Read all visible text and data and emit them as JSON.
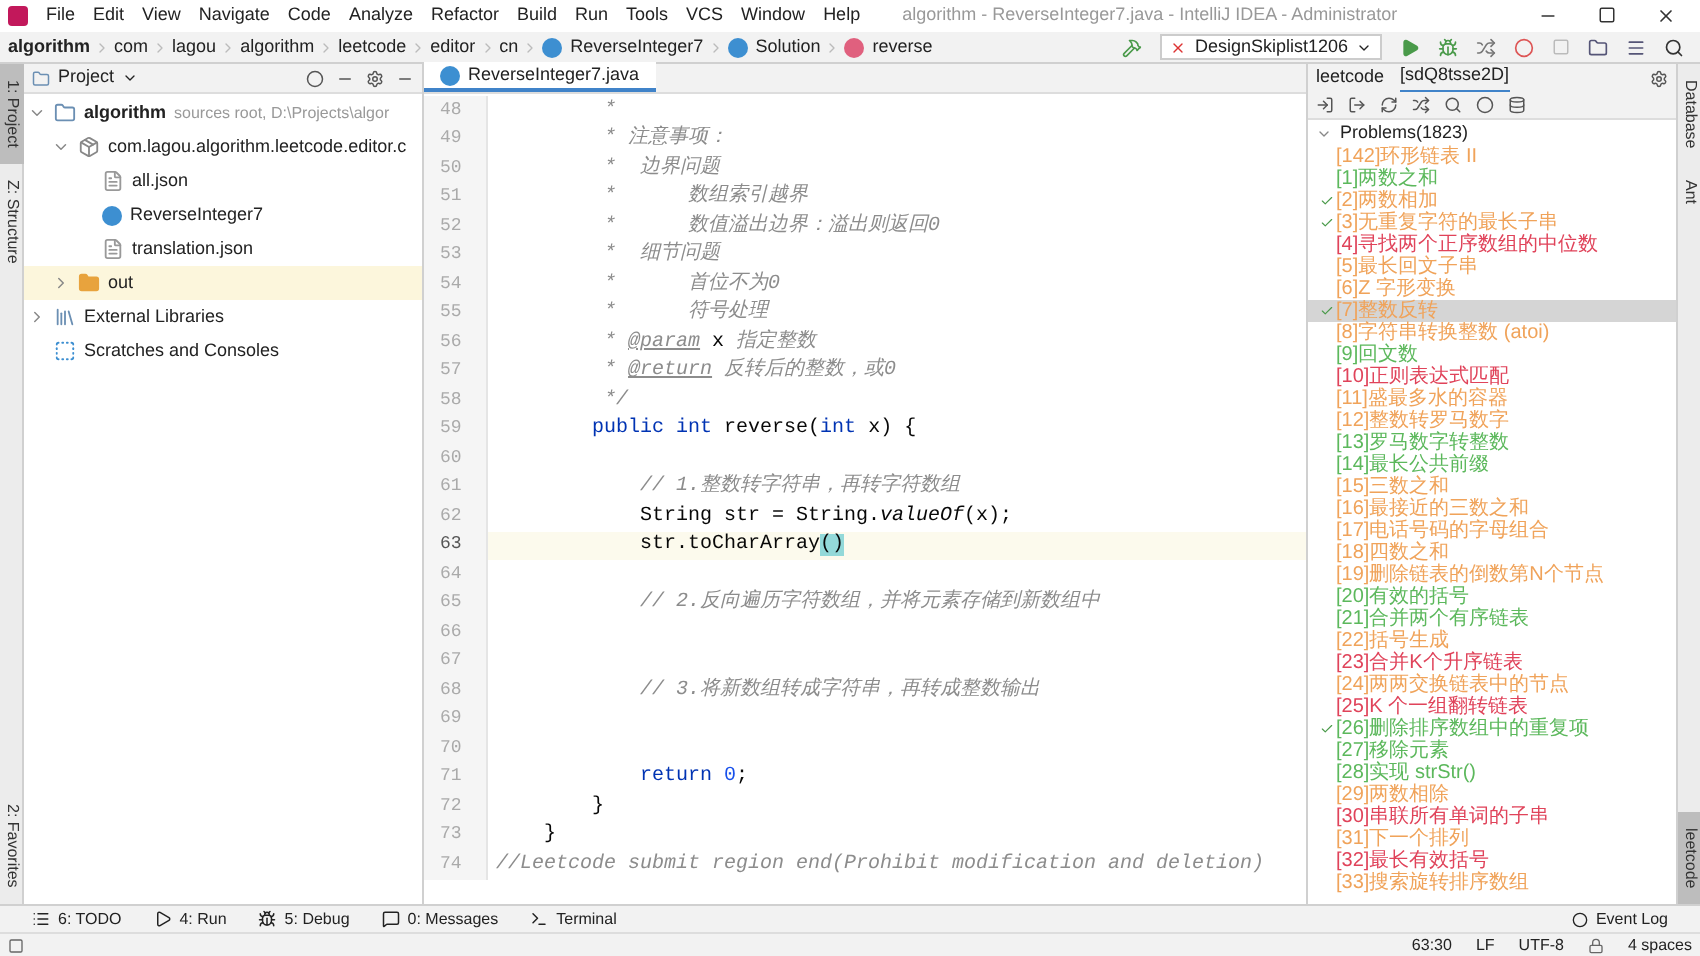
{
  "window": {
    "title": "algorithm - ReverseInteger7.java - IntelliJ IDEA - Administrator"
  },
  "menu": [
    "File",
    "Edit",
    "View",
    "Navigate",
    "Code",
    "Analyze",
    "Refactor",
    "Build",
    "Run",
    "Tools",
    "VCS",
    "Window",
    "Help"
  ],
  "breadcrumbs": [
    {
      "label": "algorithm",
      "kind": "project"
    },
    {
      "label": "com",
      "kind": "folder"
    },
    {
      "label": "lagou",
      "kind": "folder"
    },
    {
      "label": "algorithm",
      "kind": "folder"
    },
    {
      "label": "leetcode",
      "kind": "folder"
    },
    {
      "label": "editor",
      "kind": "folder"
    },
    {
      "label": "cn",
      "kind": "folder"
    },
    {
      "label": "ReverseInteger7",
      "kind": "class"
    },
    {
      "label": "Solution",
      "kind": "class"
    },
    {
      "label": "reverse",
      "kind": "method"
    }
  ],
  "run_config": "DesignSkiplist1206",
  "left_strip": [
    {
      "label": "1: Project",
      "selected": true
    },
    {
      "label": "Z: Structure",
      "selected": false
    }
  ],
  "left_strip_bottom": [
    {
      "label": "2: Favorites",
      "selected": false
    }
  ],
  "project_panel": {
    "title": "Project",
    "tree": [
      {
        "label": "algorithm",
        "note": "sources root, D:\\Projects\\algor",
        "kind": "module",
        "expanded": true,
        "selected": false,
        "children": [
          {
            "label": "com.lagou.algorithm.leetcode.editor.c",
            "kind": "package",
            "expanded": true,
            "selected": false,
            "children": [
              {
                "label": "all.json",
                "kind": "file",
                "selected": false
              },
              {
                "label": "ReverseInteger7",
                "kind": "class",
                "selected": false
              },
              {
                "label": "translation.json",
                "kind": "file",
                "selected": false
              }
            ]
          },
          {
            "label": "out",
            "kind": "folder",
            "expanded": false,
            "selected": true
          }
        ]
      },
      {
        "label": "External Libraries",
        "kind": "library",
        "expanded": false,
        "selected": false
      },
      {
        "label": "Scratches and Consoles",
        "kind": "scratch",
        "selected": false
      }
    ]
  },
  "editor": {
    "tab": "ReverseInteger7.java",
    "lines": [
      {
        "number": "48",
        "current": false,
        "segments": [
          {
            "kind": "doc",
            "text": "         *"
          }
        ]
      },
      {
        "number": "49",
        "current": false,
        "segments": [
          {
            "kind": "doc",
            "text": "         * 注意事项："
          }
        ]
      },
      {
        "number": "50",
        "current": false,
        "segments": [
          {
            "kind": "doc",
            "text": "         *  边界问题"
          }
        ]
      },
      {
        "number": "51",
        "current": false,
        "segments": [
          {
            "kind": "doc",
            "text": "         *      数组索引越界"
          }
        ]
      },
      {
        "number": "52",
        "current": false,
        "segments": [
          {
            "kind": "doc",
            "text": "         *      数值溢出边界：溢出则返回0"
          }
        ]
      },
      {
        "number": "53",
        "current": false,
        "segments": [
          {
            "kind": "doc",
            "text": "         *  细节问题"
          }
        ]
      },
      {
        "number": "54",
        "current": false,
        "segments": [
          {
            "kind": "doc",
            "text": "         *      首位不为0"
          }
        ]
      },
      {
        "number": "55",
        "current": false,
        "segments": [
          {
            "kind": "doc",
            "text": "         *      符号处理"
          }
        ]
      },
      {
        "number": "56",
        "current": false,
        "segments": [
          {
            "kind": "doc",
            "text": "         * "
          },
          {
            "kind": "doctag",
            "text": "@param"
          },
          {
            "kind": "plain",
            "text": " x "
          },
          {
            "kind": "doc",
            "text": "指定整数"
          }
        ]
      },
      {
        "number": "57",
        "current": false,
        "segments": [
          {
            "kind": "doc",
            "text": "         * "
          },
          {
            "kind": "doctag",
            "text": "@return"
          },
          {
            "kind": "doc",
            "text": " 反转后的整数，或0"
          }
        ]
      },
      {
        "number": "58",
        "current": false,
        "segments": [
          {
            "kind": "doc",
            "text": "         */"
          }
        ]
      },
      {
        "number": "59",
        "current": false,
        "segments": [
          {
            "kind": "keyword",
            "text": "        public int"
          },
          {
            "kind": "plain",
            "text": " reverse("
          },
          {
            "kind": "keyword",
            "text": "int"
          },
          {
            "kind": "plain",
            "text": " x) {"
          }
        ]
      },
      {
        "number": "60",
        "current": false
      },
      {
        "number": "61",
        "current": false,
        "segments": [
          {
            "kind": "comment",
            "text": "            // 1.整数转字符串，再转字符数组"
          }
        ]
      },
      {
        "number": "62",
        "current": false,
        "segments": [
          {
            "kind": "plain",
            "text": "            String str = String."
          },
          {
            "kind": "static",
            "text": "valueOf"
          },
          {
            "kind": "plain",
            "text": "(x);"
          }
        ]
      },
      {
        "number": "63",
        "current": true,
        "segments": [
          {
            "kind": "plain",
            "text": "            str.toCharArray"
          },
          {
            "kind": "match",
            "text": "()"
          }
        ]
      },
      {
        "number": "64",
        "current": false
      },
      {
        "number": "65",
        "current": false,
        "segments": [
          {
            "kind": "comment",
            "text": "            // 2.反向遍历字符数组，并将元素存储到新数组中"
          }
        ]
      },
      {
        "number": "66",
        "current": false
      },
      {
        "number": "67",
        "current": false
      },
      {
        "number": "68",
        "current": false,
        "segments": [
          {
            "kind": "comment",
            "text": "            // 3.将新数组转成字符串，再转成整数输出"
          }
        ]
      },
      {
        "number": "69",
        "current": false
      },
      {
        "number": "70",
        "current": false
      },
      {
        "number": "71",
        "current": false,
        "segments": [
          {
            "kind": "keyword",
            "text": "            return "
          },
          {
            "kind": "number",
            "text": "0"
          },
          {
            "kind": "plain",
            "text": ";"
          }
        ]
      },
      {
        "number": "72",
        "current": false,
        "segments": [
          {
            "kind": "plain",
            "text": "        }"
          }
        ]
      },
      {
        "number": "73",
        "current": false,
        "segments": [
          {
            "kind": "plain",
            "text": "    }"
          }
        ]
      },
      {
        "number": "74",
        "current": false,
        "segments": [
          {
            "kind": "comment",
            "text": "//Leetcode submit region end(Prohibit modification and deletion)"
          }
        ]
      }
    ]
  },
  "leetcode_panel": {
    "tabs": [
      {
        "label": "leetcode",
        "selected": false
      },
      {
        "label": "[sdQ8tsse2D]",
        "selected": true
      }
    ],
    "root": "Problems(1823)",
    "problems": [
      {
        "title": "[142]环形链表 II",
        "color": "#f0a35a",
        "checked": false,
        "selected": false
      },
      {
        "title": "[1]两数之和",
        "color": "#5cb85c",
        "checked": false,
        "selected": false
      },
      {
        "title": "[2]两数相加",
        "color": "#f0a35a",
        "checked": true,
        "selected": false
      },
      {
        "title": "[3]无重复字符的最长子串",
        "color": "#f0a35a",
        "checked": true,
        "selected": false
      },
      {
        "title": "[4]寻找两个正序数组的中位数",
        "color": "#e0435a",
        "checked": false,
        "selected": false
      },
      {
        "title": "[5]最长回文子串",
        "color": "#f0a35a",
        "checked": false,
        "selected": false
      },
      {
        "title": "[6]Z 字形变换",
        "color": "#f0a35a",
        "checked": false,
        "selected": false
      },
      {
        "title": "[7]整数反转",
        "color": "#f0a35a",
        "checked": true,
        "selected": true
      },
      {
        "title": "[8]字符串转换整数 (atoi)",
        "color": "#f0a35a",
        "checked": false,
        "selected": false
      },
      {
        "title": "[9]回文数",
        "color": "#5cb85c",
        "checked": false,
        "selected": false
      },
      {
        "title": "[10]正则表达式匹配",
        "color": "#e0435a",
        "checked": false,
        "selected": false
      },
      {
        "title": "[11]盛最多水的容器",
        "color": "#f0a35a",
        "checked": false,
        "selected": false
      },
      {
        "title": "[12]整数转罗马数字",
        "color": "#f0a35a",
        "checked": false,
        "selected": false
      },
      {
        "title": "[13]罗马数字转整数",
        "color": "#5cb85c",
        "checked": false,
        "selected": false
      },
      {
        "title": "[14]最长公共前缀",
        "color": "#5cb85c",
        "checked": false,
        "selected": false
      },
      {
        "title": "[15]三数之和",
        "color": "#f0a35a",
        "checked": false,
        "selected": false
      },
      {
        "title": "[16]最接近的三数之和",
        "color": "#f0a35a",
        "checked": false,
        "selected": false
      },
      {
        "title": "[17]电话号码的字母组合",
        "color": "#f0a35a",
        "checked": false,
        "selected": false
      },
      {
        "title": "[18]四数之和",
        "color": "#f0a35a",
        "checked": false,
        "selected": false
      },
      {
        "title": "[19]删除链表的倒数第N个节点",
        "color": "#f0a35a",
        "checked": false,
        "selected": false
      },
      {
        "title": "[20]有效的括号",
        "color": "#5cb85c",
        "checked": false,
        "selected": false
      },
      {
        "title": "[21]合并两个有序链表",
        "color": "#5cb85c",
        "checked": false,
        "selected": false
      },
      {
        "title": "[22]括号生成",
        "color": "#f0a35a",
        "checked": false,
        "selected": false
      },
      {
        "title": "[23]合并K个升序链表",
        "color": "#e0435a",
        "checked": false,
        "selected": false
      },
      {
        "title": "[24]两两交换链表中的节点",
        "color": "#f0a35a",
        "checked": false,
        "selected": false
      },
      {
        "title": "[25]K 个一组翻转链表",
        "color": "#e0435a",
        "checked": false,
        "selected": false
      },
      {
        "title": "[26]删除排序数组中的重复项",
        "color": "#5cb85c",
        "checked": true,
        "selected": false
      },
      {
        "title": "[27]移除元素",
        "color": "#5cb85c",
        "checked": false,
        "selected": false
      },
      {
        "title": "[28]实现 strStr()",
        "color": "#5cb85c",
        "checked": false,
        "selected": false
      },
      {
        "title": "[29]两数相除",
        "color": "#f0a35a",
        "checked": false,
        "selected": false
      },
      {
        "title": "[30]串联所有单词的子串",
        "color": "#e0435a",
        "checked": false,
        "selected": false
      },
      {
        "title": "[31]下一个排列",
        "color": "#f0a35a",
        "checked": false,
        "selected": false
      },
      {
        "title": "[32]最长有效括号",
        "color": "#e0435a",
        "checked": false,
        "selected": false
      },
      {
        "title": "[33]搜索旋转排序数组",
        "color": "#f0a35a",
        "checked": false,
        "selected": false
      }
    ]
  },
  "right_strip": [
    {
      "label": "Database",
      "selected": false
    },
    {
      "label": "Ant",
      "selected": false
    }
  ],
  "right_strip_bottom": [
    {
      "label": "leetcode",
      "selected": true
    }
  ],
  "tool_buttons": [
    {
      "label": "6: TODO",
      "kind": "todo"
    },
    {
      "label": "4: Run",
      "kind": "run"
    },
    {
      "label": "5: Debug",
      "kind": "debug"
    },
    {
      "label": "0: Messages",
      "kind": "messages"
    },
    {
      "label": "Terminal",
      "kind": "terminal"
    }
  ],
  "event_log": "Event Log",
  "status_bar": {
    "position": "63:30",
    "line_separator": "LF",
    "encoding": "UTF-8",
    "indent": "4 spaces"
  }
}
